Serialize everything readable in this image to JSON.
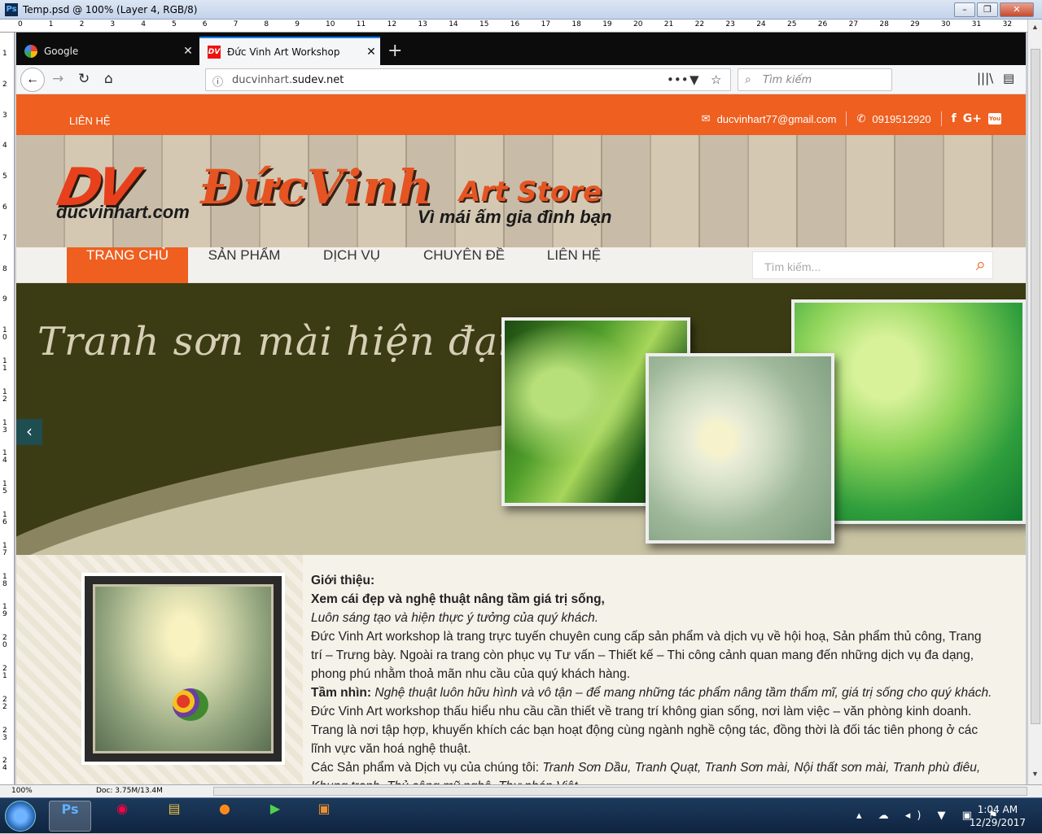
{
  "photoshop": {
    "title": "Temp.psd @ 100% (Layer 4, RGB/8)",
    "ruler_top": [
      "0",
      "1",
      "2",
      "3",
      "4",
      "5",
      "6",
      "7",
      "8",
      "9",
      "10",
      "11",
      "12",
      "13",
      "14",
      "15",
      "16",
      "17",
      "18",
      "19",
      "20",
      "21",
      "22",
      "23",
      "24",
      "25",
      "26",
      "27",
      "28",
      "29",
      "30",
      "31",
      "32"
    ],
    "ruler_left": [
      "1",
      "2",
      "3",
      "4",
      "5",
      "6",
      "7",
      "8",
      "9",
      "10",
      "11",
      "12",
      "13",
      "14",
      "15",
      "16",
      "17",
      "18",
      "19",
      "20",
      "21",
      "22",
      "23",
      "24"
    ],
    "zoom": "100%",
    "doc_size": "Doc: 3.75M/13.4M"
  },
  "browser": {
    "tabs": [
      {
        "label": "Google",
        "icon": "google-icon"
      },
      {
        "label": "Đức Vinh Art Workshop",
        "icon": "dv-favicon"
      }
    ],
    "url_host_prefix": "ducvinhart.",
    "url_host_domain": "sudev.net",
    "search_placeholder": "Tìm kiếm"
  },
  "site": {
    "topbar": {
      "contact_link": "LIÊN HỆ",
      "email": "ducvinhart77@gmail.com",
      "phone": "0919512920"
    },
    "header": {
      "logo_mark": "DV",
      "logo_url": "ducvinhart.com",
      "brand": "ĐứcVinh",
      "brand_sub": "Art Store",
      "slogan": "Vì mái ấm gia đình bạn"
    },
    "menu": {
      "items": [
        "TRANG CHỦ",
        "SẢN PHẨM",
        "DỊCH VỤ",
        "CHUYÊN ĐỀ",
        "LIÊN HỆ"
      ],
      "search_placeholder": "Tìm kiếm..."
    },
    "banner": {
      "headline": "Tranh sơn mài hiện đại"
    },
    "intro": {
      "heading": "Giới thiệu:",
      "tagline": "Xem cái đẹp và nghệ thuật nâng tầm giá trị sống,",
      "subtagline": "Luôn sáng tạo và hiện thực ý tưởng của quý khách.",
      "paragraph1": "Đức Vinh Art workshop là trang trực tuyến chuyên cung cấp sản phẩm và dịch vụ về hội hoạ, Sản phẩm thủ công, Trang trí – Trưng bày. Ngoài ra trang còn phục vụ Tư vấn – Thiết kế – Thi công cảnh quan mang đến những dịch vụ đa dạng, phong phú nhằm thoả mãn nhu cầu của quý khách hàng.",
      "vision_label": "Tầm nhìn:",
      "vision_italic": "Nghệ thuật luôn hữu hình và vô tận – để mang những tác phẩm nâng tầm thẩm mĩ, giá trị sống cho quý khách.",
      "vision_rest": "Đức Vinh Art workshop  thấu hiểu nhu cầu cần thiết về trang trí không gian sống, nơi làm việc – văn phòng kinh doanh. Trang là nơi tập hợp, khuyến khích các bạn hoạt động cùng ngành nghề cộng tác, đồng thời là đối tác tiên phong ở các lĩnh vực văn hoá nghệ thuật.",
      "products_label": "Các Sản phẩm và Dịch vụ của chúng tôi:",
      "products_list": "Tranh Sơn Dầu, Tranh Quạt, Tranh Sơn mài, Nội thất sơn mài, Tranh phù điêu, Khung tranh, Thủ công mỹ nghệ, Thư pháp Việt"
    },
    "colors": {
      "accent": "#ee5f20",
      "banner_bg": "#3c3c14"
    }
  },
  "taskbar": {
    "apps": [
      "photoshop-icon",
      "chrome-icon",
      "file-explorer-icon",
      "firefox-icon",
      "media-player-icon",
      "media-center-icon"
    ],
    "time": "1:04 AM",
    "date": "12/29/2017"
  }
}
